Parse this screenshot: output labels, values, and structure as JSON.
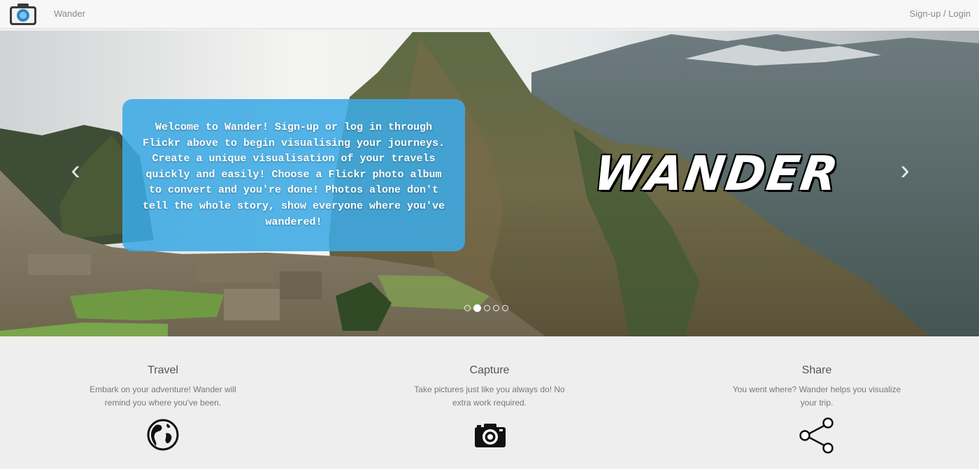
{
  "navbar": {
    "brand": "Wander",
    "login_label": "Sign-up / Login",
    "logo_icon": "camera-logo-icon"
  },
  "hero": {
    "caption": "Welcome to Wander! Sign-up or log in through Flickr above to begin visualising your journeys. Create a unique visualisation of your travels quickly and easily! Choose a Flickr photo album to convert and you're done! Photos alone don't tell the whole story, show everyone where you've wandered!",
    "title": "WANDER",
    "prev_icon": "chevron-left-icon",
    "next_icon": "chevron-right-icon",
    "slide_count": 5,
    "active_slide": 2,
    "caption_color": "#3caae4"
  },
  "features": [
    {
      "title": "Travel",
      "text_line1": "Embark on your adventure! Wander will",
      "text_line2": "remind you where you've been.",
      "icon": "globe-icon"
    },
    {
      "title": "Capture",
      "text_line1": "Take pictures just like you always do! No",
      "text_line2": "extra work required.",
      "icon": "camera-icon"
    },
    {
      "title": "Share",
      "text_line1": "You went where? Wander helps you visualize",
      "text_line2": "your trip.",
      "icon": "share-icon"
    }
  ]
}
